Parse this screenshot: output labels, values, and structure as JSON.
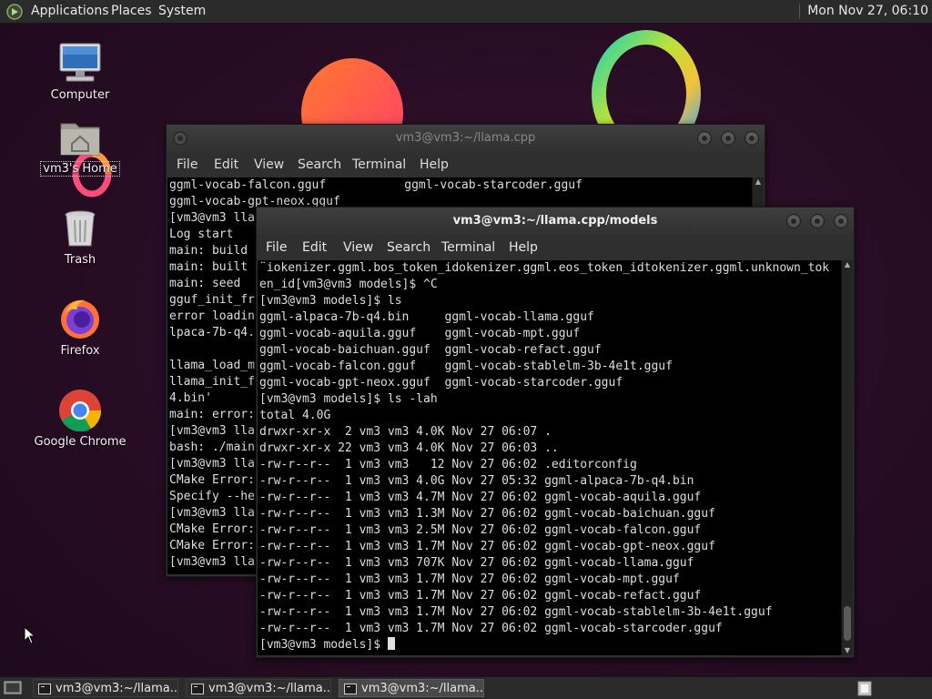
{
  "top_panel": {
    "menus": [
      "Applications",
      "Places",
      "System"
    ],
    "clock": "Mon Nov 27, 06:10"
  },
  "desktop_icons": [
    {
      "label": "Computer",
      "icon": "computer-icon"
    },
    {
      "label": "vm3's Home",
      "icon": "home-folder-icon"
    },
    {
      "label": "Trash",
      "icon": "trash-icon"
    },
    {
      "label": "Firefox",
      "icon": "firefox-icon"
    },
    {
      "label": "Google Chrome",
      "icon": "chrome-icon"
    }
  ],
  "back_terminal": {
    "title": "vm3@vm3:~/llama.cpp",
    "menu": [
      "File",
      "Edit",
      "View",
      "Search",
      "Terminal",
      "Help"
    ],
    "lines": [
      "ggml-vocab-falcon.gguf           ggml-vocab-starcoder.gguf",
      "ggml-vocab-gpt-neox.gguf",
      "[vm3@vm3 lla",
      "Log start",
      "main: build",
      "main: built",
      "main: seed",
      "gguf_init_fr",
      "error loadin",
      "lpaca-7b-q4.",
      "",
      "llama_load_m",
      "llama_init_f",
      "4.bin'",
      "main: error:",
      "[vm3@vm3 lla",
      "bash: ./main",
      "[vm3@vm3 lla",
      "CMake Error:",
      "Specify --he",
      "[vm3@vm3 lla",
      "CMake Error:",
      "CMake Error:",
      "[vm3@vm3 lla"
    ]
  },
  "front_terminal": {
    "title": "vm3@vm3:~/llama.cpp/models",
    "menu": [
      "File",
      "Edit",
      "View",
      "Search",
      "Terminal",
      "Help"
    ],
    "lines": [
      "¨iokenizer.ggml.bos_token_idokenizer.ggml.eos_token_idtokenizer.ggml.unknown_tok",
      "en_id[vm3@vm3 models]$ ^C",
      "[vm3@vm3 models]$ ls",
      "ggml-alpaca-7b-q4.bin     ggml-vocab-llama.gguf",
      "ggml-vocab-aquila.gguf    ggml-vocab-mpt.gguf",
      "ggml-vocab-baichuan.gguf  ggml-vocab-refact.gguf",
      "ggml-vocab-falcon.gguf    ggml-vocab-stablelm-3b-4e1t.gguf",
      "ggml-vocab-gpt-neox.gguf  ggml-vocab-starcoder.gguf",
      "[vm3@vm3 models]$ ls -lah",
      "total 4.0G",
      "drwxr-xr-x  2 vm3 vm3 4.0K Nov 27 06:07 .",
      "drwxr-xr-x 22 vm3 vm3 4.0K Nov 27 06:03 ..",
      "-rw-r--r--  1 vm3 vm3   12 Nov 27 06:02 .editorconfig",
      "-rw-r--r--  1 vm3 vm3 4.0G Nov 27 05:32 ggml-alpaca-7b-q4.bin",
      "-rw-r--r--  1 vm3 vm3 4.7M Nov 27 06:02 ggml-vocab-aquila.gguf",
      "-rw-r--r--  1 vm3 vm3 1.3M Nov 27 06:02 ggml-vocab-baichuan.gguf",
      "-rw-r--r--  1 vm3 vm3 2.5M Nov 27 06:02 ggml-vocab-falcon.gguf",
      "-rw-r--r--  1 vm3 vm3 1.7M Nov 27 06:02 ggml-vocab-gpt-neox.gguf",
      "-rw-r--r--  1 vm3 vm3 707K Nov 27 06:02 ggml-vocab-llama.gguf",
      "-rw-r--r--  1 vm3 vm3 1.7M Nov 27 06:02 ggml-vocab-mpt.gguf",
      "-rw-r--r--  1 vm3 vm3 1.7M Nov 27 06:02 ggml-vocab-refact.gguf",
      "-rw-r--r--  1 vm3 vm3 1.7M Nov 27 06:02 ggml-vocab-stablelm-3b-4e1t.gguf",
      "-rw-r--r--  1 vm3 vm3 1.7M Nov 27 06:02 ggml-vocab-starcoder.gguf",
      "[vm3@vm3 models]$ "
    ]
  },
  "taskbar": {
    "items": [
      {
        "label": "vm3@vm3:~/llama....",
        "active": false
      },
      {
        "label": "vm3@vm3:~/llama....",
        "active": false
      },
      {
        "label": "vm3@vm3:~/llama....",
        "active": true
      }
    ]
  },
  "colors": {
    "panel": "#2b2b2b",
    "terminal_bg": "#000000",
    "terminal_fg": "#dedede",
    "wallpaper": "#2a0d26"
  }
}
